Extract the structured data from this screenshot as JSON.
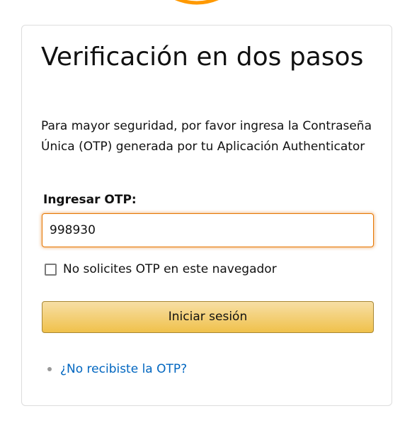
{
  "colors": {
    "accent_orange": "#e77600",
    "button_yellow": "#f0c14b",
    "link_blue": "#0066c0",
    "border_gray": "#dddddd"
  },
  "logo": {
    "icon": "amazon-smile-arc-icon"
  },
  "form": {
    "title": "Verificación en dos pasos",
    "description": "Para mayor seguridad, por favor ingresa la Contraseña Única (OTP) generada por tu Aplicación Authenticator",
    "otp_label": "Ingresar OTP:",
    "otp_value": "998930",
    "remember_checkbox": {
      "label": "No solicites OTP en este navegador",
      "checked": false
    },
    "submit_label": "Iniciar sesión",
    "resend_link": "¿No recibiste la OTP?"
  }
}
